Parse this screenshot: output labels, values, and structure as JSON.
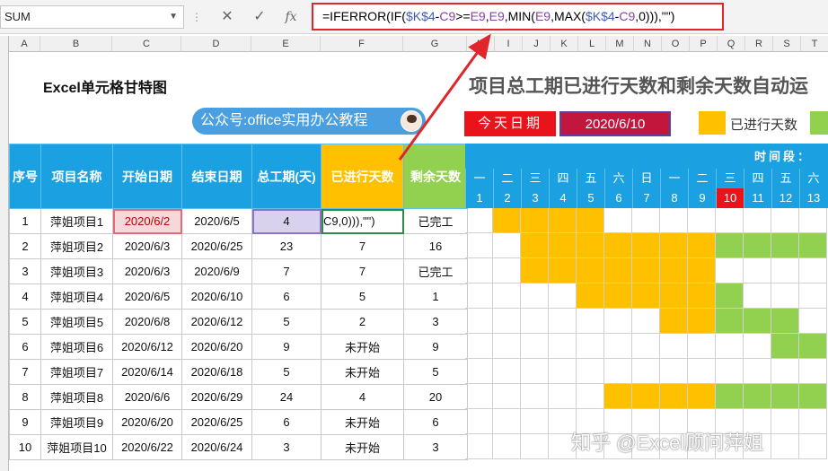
{
  "formula_bar": {
    "name_box": "SUM",
    "formula_parts": [
      "=IFERROR(IF(",
      "$K$4",
      "-",
      "C9",
      ">=",
      "E9",
      ",",
      "E9",
      ",MIN(",
      "E9",
      ",MAX(",
      "$K$4",
      "-",
      "C9",
      ",0))),\"\")"
    ],
    "cancel_icon": "✕",
    "enter_icon": "✓",
    "fx_label": "fx"
  },
  "columns": [
    "A",
    "B",
    "C",
    "D",
    "E",
    "F",
    "G",
    "H",
    "I",
    "J",
    "K",
    "L",
    "M",
    "N",
    "O",
    "P",
    "Q",
    "R",
    "S",
    "T"
  ],
  "sheet": {
    "title": "Excel单元格甘特图",
    "badge": "公众号:office实用办公教程",
    "subtitle": "项目总工期已进行天数和剩余天数自动运",
    "today_label": "今天日期",
    "today_value": "2020/6/10",
    "legend_progress": "已进行天数",
    "colors": {
      "progress": "#ffc000",
      "remaining": "#92d050",
      "header": "#1ba1e2",
      "today": "#e8131b"
    }
  },
  "table": {
    "headers": [
      "序号",
      "项目名称",
      "开始日期",
      "结束日期",
      "总工期(天)",
      "已进行天数",
      "剩余天数"
    ],
    "rows": [
      {
        "no": "1",
        "name": "萍姐项目1",
        "start": "2020/6/2",
        "end": "2020/6/5",
        "total": "4",
        "done": "C9,0))),\"\")",
        "remain": "已完工"
      },
      {
        "no": "2",
        "name": "萍姐项目2",
        "start": "2020/6/3",
        "end": "2020/6/25",
        "total": "23",
        "done": "7",
        "remain": "16"
      },
      {
        "no": "3",
        "name": "萍姐项目3",
        "start": "2020/6/3",
        "end": "2020/6/9",
        "total": "7",
        "done": "7",
        "remain": "已完工"
      },
      {
        "no": "4",
        "name": "萍姐项目4",
        "start": "2020/6/5",
        "end": "2020/6/10",
        "total": "6",
        "done": "5",
        "remain": "1"
      },
      {
        "no": "5",
        "name": "萍姐项目5",
        "start": "2020/6/8",
        "end": "2020/6/12",
        "total": "5",
        "done": "2",
        "remain": "3"
      },
      {
        "no": "6",
        "name": "萍姐项目6",
        "start": "2020/6/12",
        "end": "2020/6/20",
        "total": "9",
        "done": "未开始",
        "remain": "9"
      },
      {
        "no": "7",
        "name": "萍姐项目7",
        "start": "2020/6/14",
        "end": "2020/6/18",
        "total": "5",
        "done": "未开始",
        "remain": "5"
      },
      {
        "no": "8",
        "name": "萍姐项目8",
        "start": "2020/6/6",
        "end": "2020/6/29",
        "total": "24",
        "done": "4",
        "remain": "20"
      },
      {
        "no": "9",
        "name": "萍姐项目9",
        "start": "2020/6/20",
        "end": "2020/6/25",
        "total": "6",
        "done": "未开始",
        "remain": "6"
      },
      {
        "no": "10",
        "name": "萍姐项目10",
        "start": "2020/6/22",
        "end": "2020/6/24",
        "total": "3",
        "done": "未开始",
        "remain": "3"
      }
    ]
  },
  "gantt": {
    "period_label": "时间段：",
    "weekdays": [
      "一",
      "二",
      "三",
      "四",
      "五",
      "六",
      "日",
      "一",
      "二",
      "三",
      "四",
      "五",
      "六"
    ],
    "days": [
      "1",
      "2",
      "3",
      "4",
      "5",
      "6",
      "7",
      "8",
      "9",
      "10",
      "11",
      "12",
      "13"
    ],
    "today_day_index": 9,
    "row_status": [
      [
        "",
        "p",
        "p",
        "p",
        "p",
        "",
        "",
        "",
        "",
        "",
        "",
        "",
        ""
      ],
      [
        "",
        "",
        "p",
        "p",
        "p",
        "p",
        "p",
        "p",
        "p",
        "r",
        "r",
        "r",
        "r"
      ],
      [
        "",
        "",
        "p",
        "p",
        "p",
        "p",
        "p",
        "p",
        "p",
        "",
        "",
        "",
        ""
      ],
      [
        "",
        "",
        "",
        "",
        "p",
        "p",
        "p",
        "p",
        "p",
        "r",
        "",
        "",
        ""
      ],
      [
        "",
        "",
        "",
        "",
        "",
        "",
        "",
        "p",
        "p",
        "r",
        "r",
        "r",
        ""
      ],
      [
        "",
        "",
        "",
        "",
        "",
        "",
        "",
        "",
        "",
        "",
        "",
        "r",
        "r"
      ],
      [
        "",
        "",
        "",
        "",
        "",
        "",
        "",
        "",
        "",
        "",
        "",
        "",
        ""
      ],
      [
        "",
        "",
        "",
        "",
        "",
        "p",
        "p",
        "p",
        "p",
        "r",
        "r",
        "r",
        "r"
      ],
      [
        "",
        "",
        "",
        "",
        "",
        "",
        "",
        "",
        "",
        "",
        "",
        "",
        ""
      ],
      [
        "",
        "",
        "",
        "",
        "",
        "",
        "",
        "",
        "",
        "",
        "",
        "",
        ""
      ]
    ]
  },
  "watermark": "知乎 @Excel顾问萍姐"
}
